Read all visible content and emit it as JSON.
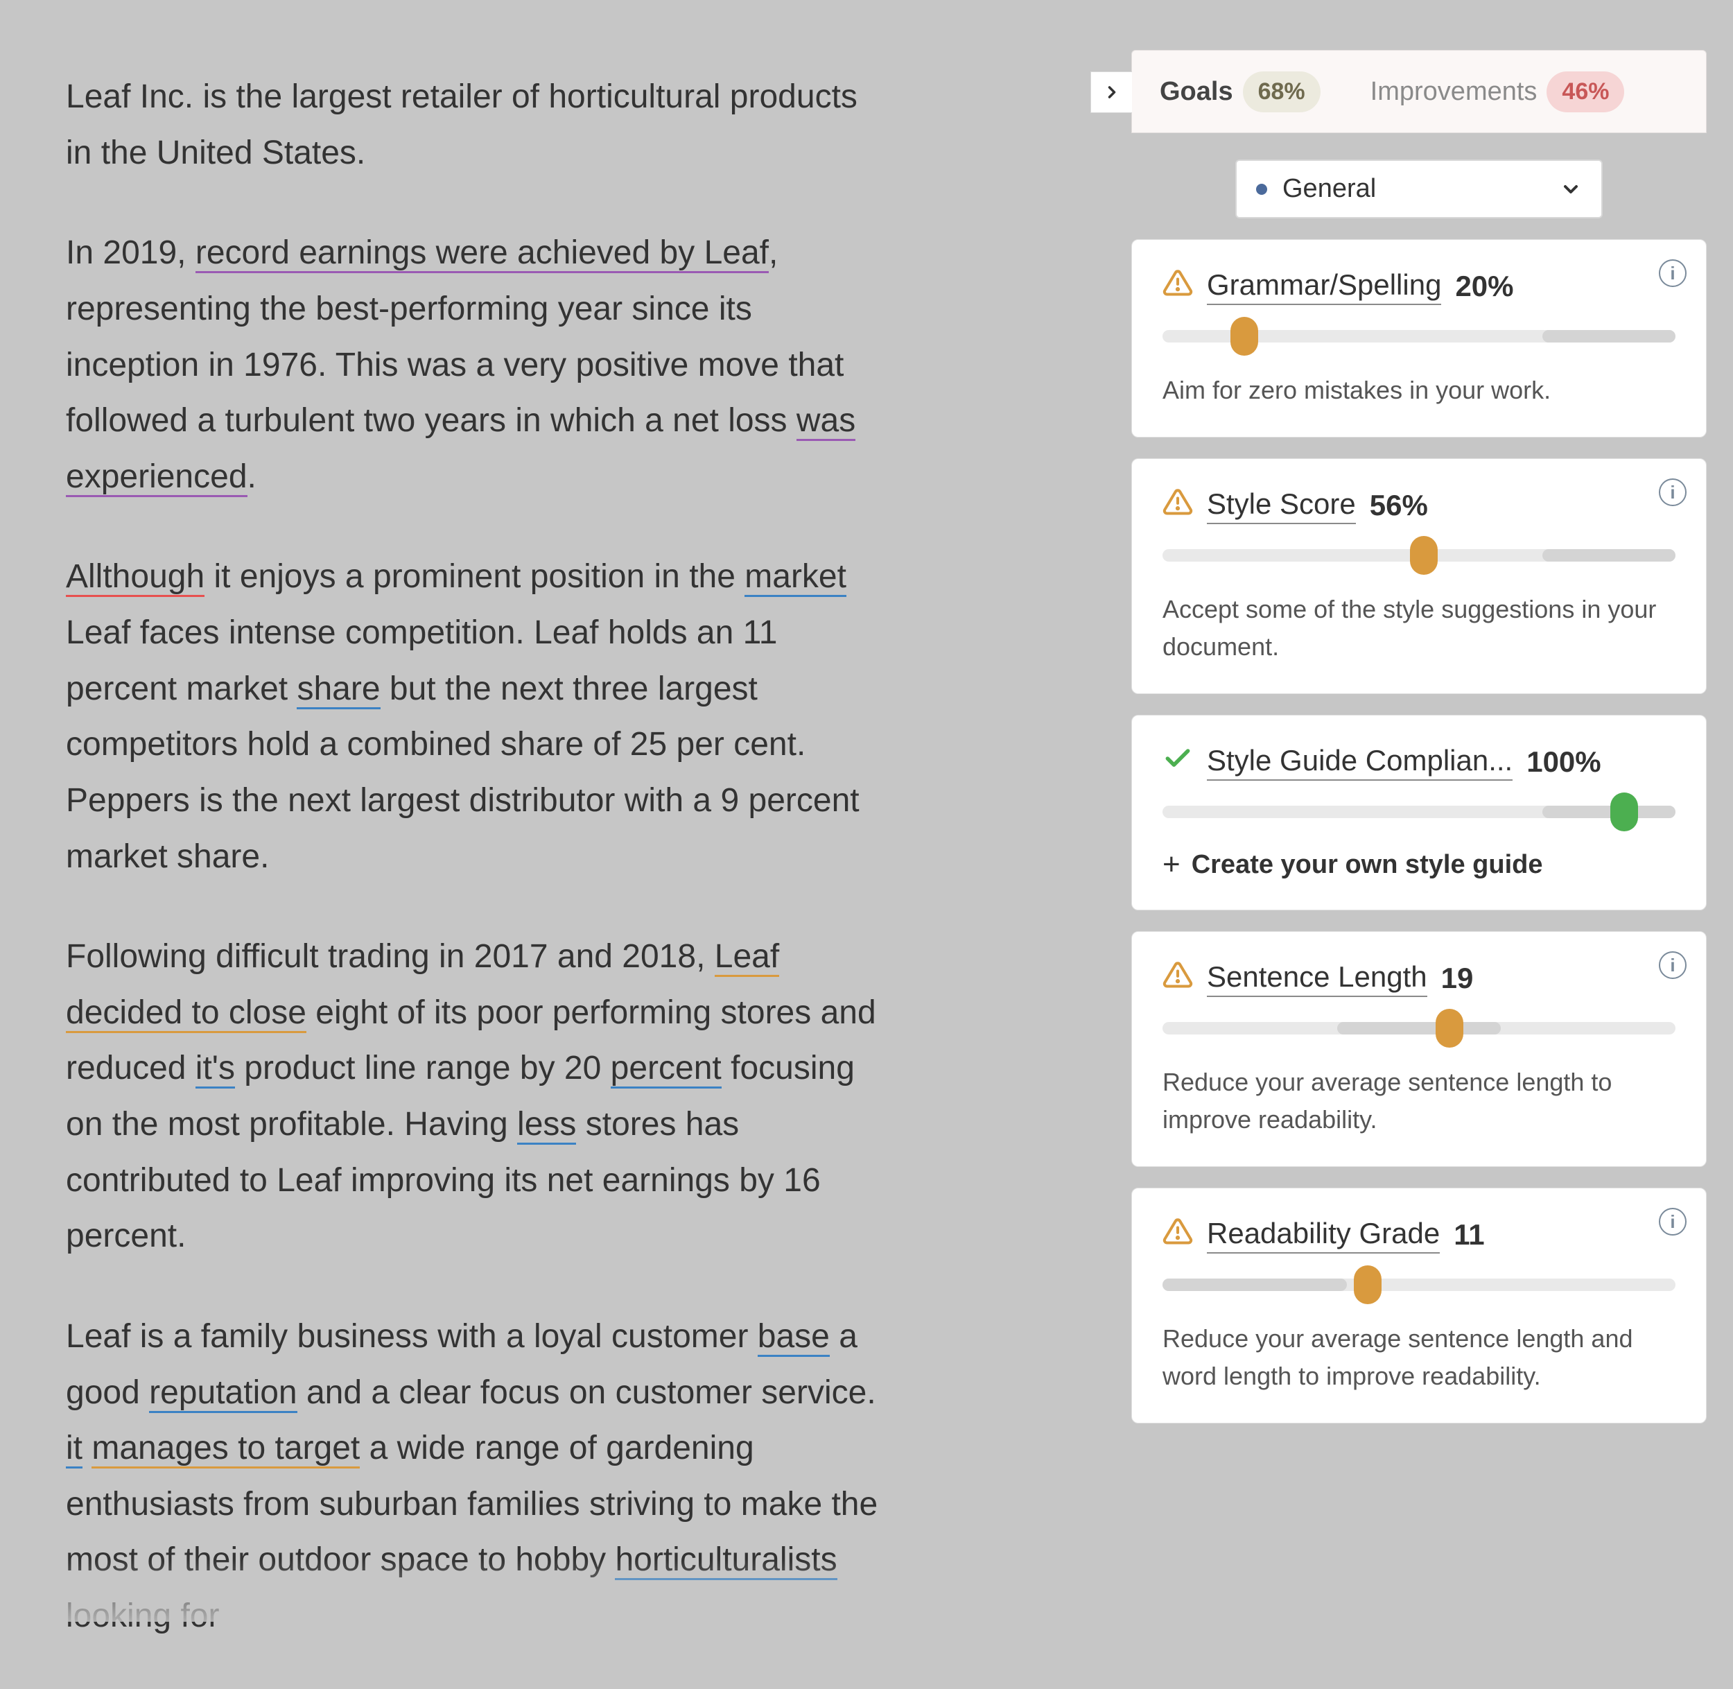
{
  "document": {
    "paragraphs": [
      "Leaf Inc. is the largest retailer of horticultural products in the United States.",
      "In 2019, record earnings were achieved by Leaf, representing the best-performing year since its inception in 1976. This was a very positive move that followed a turbulent two years in which a net loss was experienced.",
      "Allthough it enjoys a prominent position in the market Leaf faces intense competition. Leaf holds an 11 percent market share but the next three largest competitors hold a combined share of 25 per cent. Peppers is the next largest distributor with a 9 percent market share.",
      "Following difficult trading in 2017 and 2018, Leaf decided to close eight of its poor performing stores and reduced it's product line range by 20 percent focusing on the most profitable. Having less stores has contributed to Leaf improving its net earnings by 16 percent.",
      "Leaf is a family business with a loyal customer base a good reputation and a clear focus on customer service. it manages to target a wide range of gardening enthusiasts from suburban families striving to make the most of their outdoor space to hobby horticulturalists looking for"
    ],
    "underlines": {
      "purple": [
        "record earnings were achieved by Leaf",
        "was experienced"
      ],
      "red": [
        "Allthough"
      ],
      "blue": [
        "market",
        "share",
        "it's",
        "percent",
        "less",
        "base",
        "reputation",
        "it",
        "horticulturalists"
      ],
      "orange": [
        "Leaf decided to close",
        "manages to target"
      ]
    }
  },
  "panel": {
    "tabs": {
      "goals": {
        "label": "Goals",
        "badge": "68%"
      },
      "improvements": {
        "label": "Improvements",
        "badge": "46%"
      }
    },
    "selector": {
      "label": "General"
    },
    "cards": [
      {
        "id": "grammar",
        "status": "warn",
        "title": "Grammar/Spelling",
        "value": "20%",
        "slider": {
          "knob": 16,
          "seg_start": 74,
          "seg_end": 100,
          "knob_color": "orange"
        },
        "desc": "Aim for zero mistakes in your work.",
        "has_info": true
      },
      {
        "id": "style",
        "status": "warn",
        "title": "Style Score",
        "value": "56%",
        "slider": {
          "knob": 51,
          "seg_start": 74,
          "seg_end": 100,
          "knob_color": "orange"
        },
        "desc": "Accept some of the style suggestions in your document.",
        "has_info": true
      },
      {
        "id": "styleguide",
        "status": "check",
        "title": "Style Guide Complian...",
        "value": "100%",
        "slider": {
          "knob": 90,
          "seg_start": 74,
          "seg_end": 100,
          "knob_color": "green"
        },
        "create_link": "Create your own style guide",
        "has_info": false
      },
      {
        "id": "sentence",
        "status": "warn",
        "title": "Sentence Length",
        "value": "19",
        "slider": {
          "knob": 56,
          "seg_start": 34,
          "seg_end": 66,
          "knob_color": "orange"
        },
        "desc": "Reduce your average sentence length to improve readability.",
        "has_info": true
      },
      {
        "id": "readability",
        "status": "warn",
        "title": "Readability Grade",
        "value": "11",
        "slider": {
          "knob": 40,
          "seg_start": 0,
          "seg_end": 36,
          "knob_color": "orange"
        },
        "desc": "Reduce your average sentence length and word length to improve readability.",
        "has_info": true
      }
    ]
  }
}
